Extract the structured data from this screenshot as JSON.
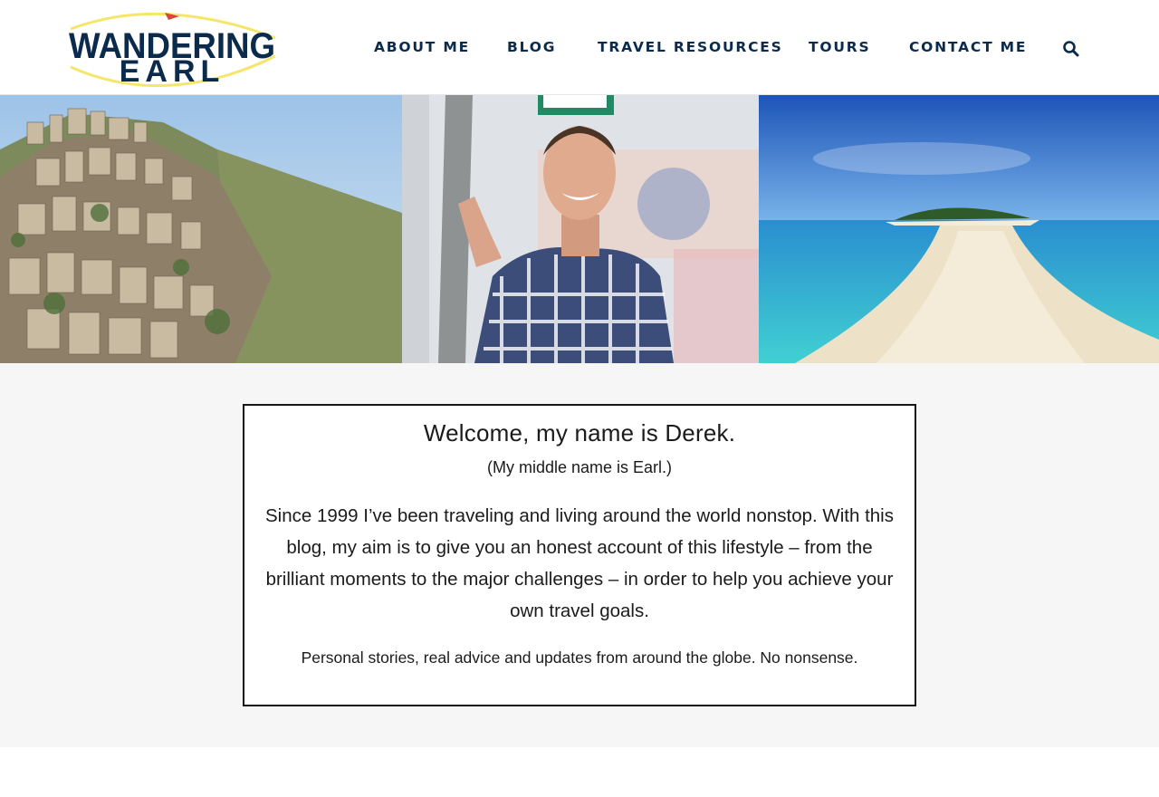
{
  "site": {
    "logo_line1": "WANDERING",
    "logo_line2": "EARL",
    "colors": {
      "navy": "#0b2b4c",
      "accent_yellow": "#f5e66b",
      "accent_red": "#d9463b"
    }
  },
  "nav": {
    "items": [
      {
        "label": "ABOUT ME"
      },
      {
        "label": "BLOG"
      },
      {
        "label": "TRAVEL RESOURCES"
      },
      {
        "label": "TOURS"
      },
      {
        "label": "CONTACT ME"
      }
    ],
    "search_icon": "search-icon"
  },
  "hero": {
    "images": [
      "mountain-village-photo",
      "traveler-portrait-photo",
      "tropical-sandbar-beach-photo"
    ]
  },
  "intro": {
    "heading": "Welcome, my name is Derek.",
    "subheading": "(My middle name is Earl.)",
    "body": "Since 1999 I’ve been traveling and living around the world nonstop. With this blog, my aim is to give you an honest account of this lifestyle – from the brilliant moments to the major challenges – in order to help you achieve your own travel goals.",
    "tagline": "Personal stories, real advice and updates from around the globe. No nonsense."
  }
}
